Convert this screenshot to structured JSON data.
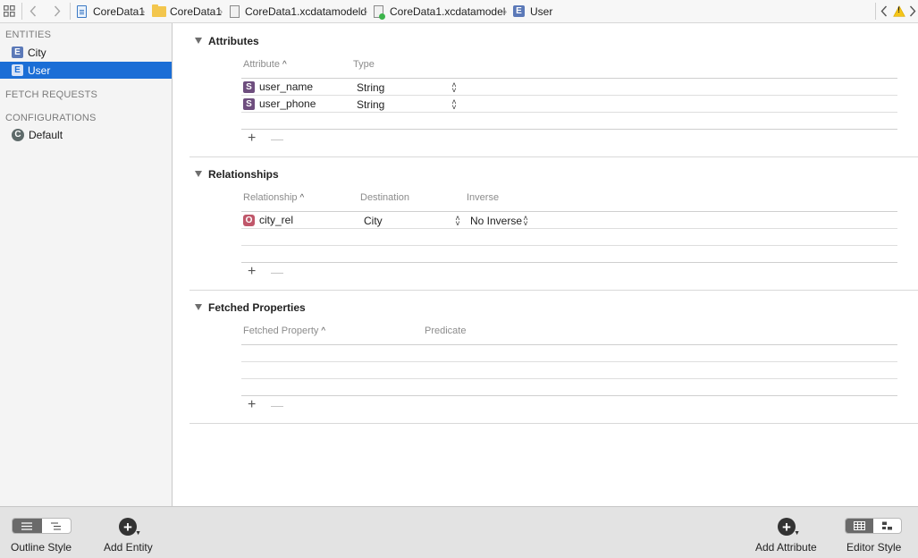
{
  "jumpbar": {
    "crumbs": [
      "CoreData1",
      "CoreData1",
      "CoreData1.xcdatamodeld",
      "CoreData1.xcdatamodel",
      "User"
    ],
    "warning_symbol": "!"
  },
  "sidebar": {
    "entities_header": "ENTITIES",
    "entities": [
      {
        "badge": "E",
        "label": "City",
        "selected": false
      },
      {
        "badge": "E",
        "label": "User",
        "selected": true
      }
    ],
    "fetch_requests_header": "FETCH REQUESTS",
    "configurations_header": "CONFIGURATIONS",
    "configurations": [
      {
        "badge": "C",
        "label": "Default"
      }
    ]
  },
  "attributes": {
    "title": "Attributes",
    "col_attribute": "Attribute",
    "col_type": "Type",
    "rows": [
      {
        "badge": "S",
        "name": "user_name",
        "type": "String"
      },
      {
        "badge": "S",
        "name": "user_phone",
        "type": "String"
      }
    ]
  },
  "relationships": {
    "title": "Relationships",
    "col_relationship": "Relationship",
    "col_destination": "Destination",
    "col_inverse": "Inverse",
    "rows": [
      {
        "badge": "O",
        "name": "city_rel",
        "destination": "City",
        "inverse": "No Inverse"
      }
    ]
  },
  "fetched_properties": {
    "title": "Fetched Properties",
    "col_fetched_property": "Fetched Property",
    "col_predicate": "Predicate",
    "rows": []
  },
  "controls": {
    "plus": "+",
    "minus": "—",
    "sort_arrow": "^",
    "round_plus": "+"
  },
  "bottombar": {
    "outline_style_label": "Outline Style",
    "add_entity_label": "Add Entity",
    "add_attribute_label": "Add Attribute",
    "editor_style_label": "Editor Style"
  },
  "colors": {
    "selection": "#1b6ed6",
    "entity_badge": "#5b79b8",
    "attribute_badge": "#6e4e7e",
    "relationship_badge": "#c0576a",
    "warning": "#f5c518"
  }
}
